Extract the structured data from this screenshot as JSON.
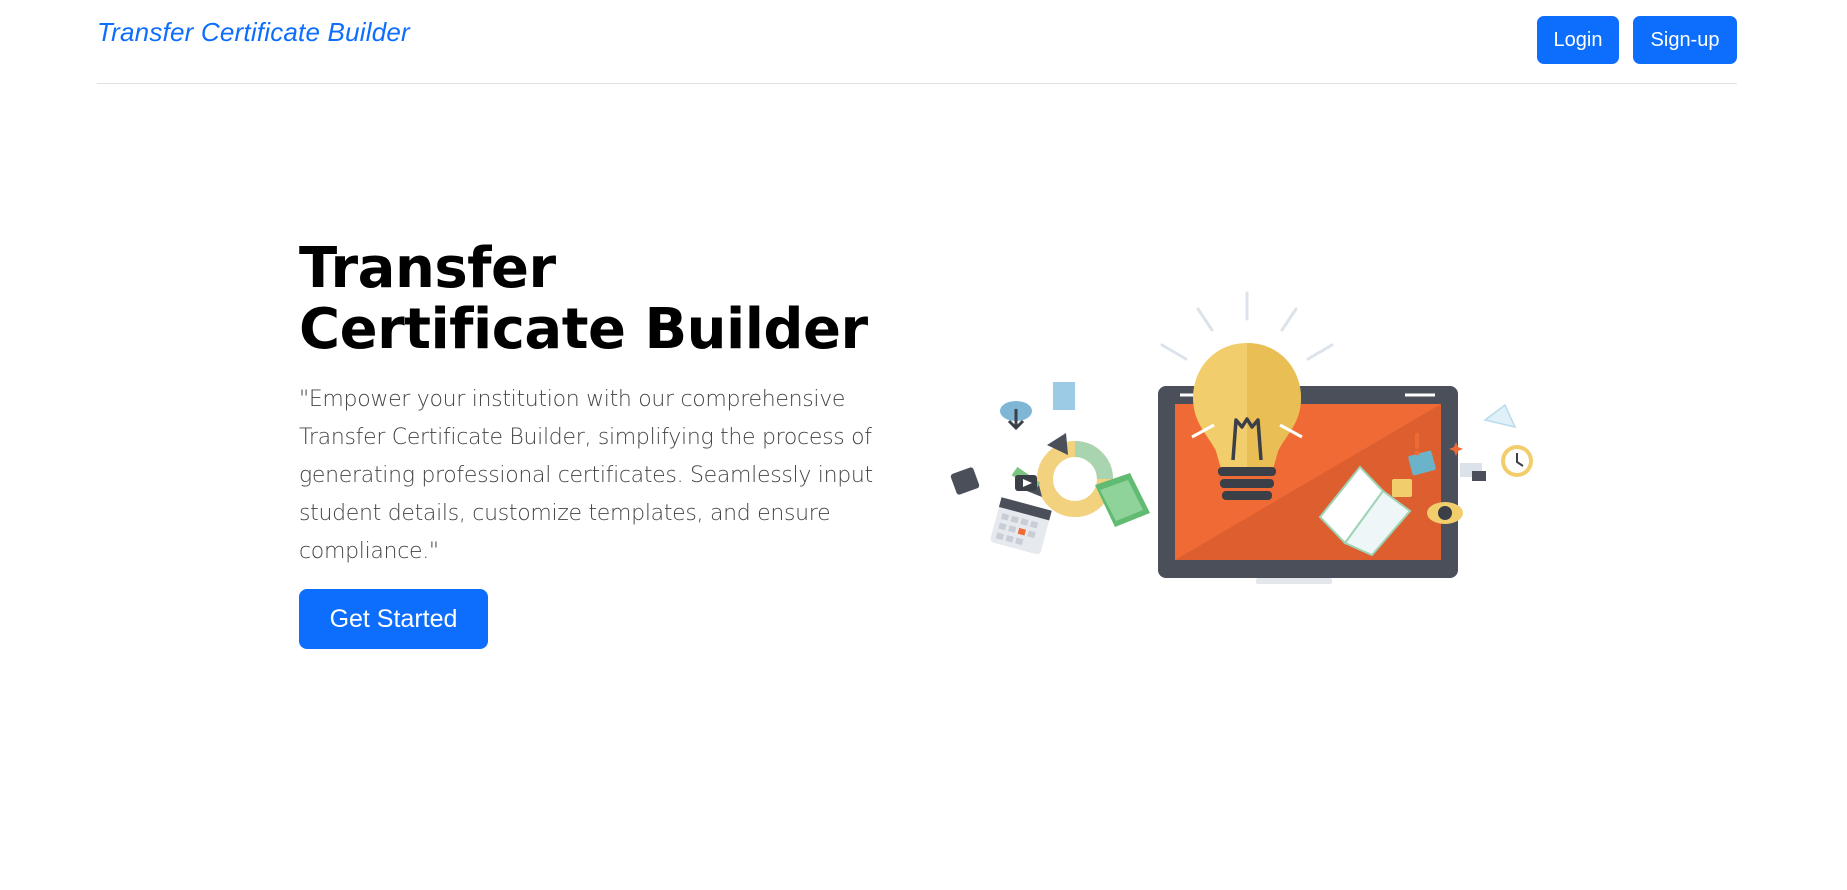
{
  "navbar": {
    "brand": "Transfer Certificate Builder",
    "login_label": "Login",
    "signup_label": "Sign-up"
  },
  "hero": {
    "title": "Transfer Certificate Builder",
    "description": "\"Empower your institution with our comprehensive Transfer Certificate Builder, simplifying the process of generating professional certificates. Seamlessly input student details, customize templates, and ensure compliance.\"",
    "cta_label": "Get Started"
  },
  "colors": {
    "accent": "#0d6efd",
    "monitor_screen": "#f06a35",
    "bulb": "#f2cd6b",
    "monitor_frame": "#4a4f59"
  },
  "illustration": {
    "icon": "lightbulb-monitor-illustration"
  }
}
